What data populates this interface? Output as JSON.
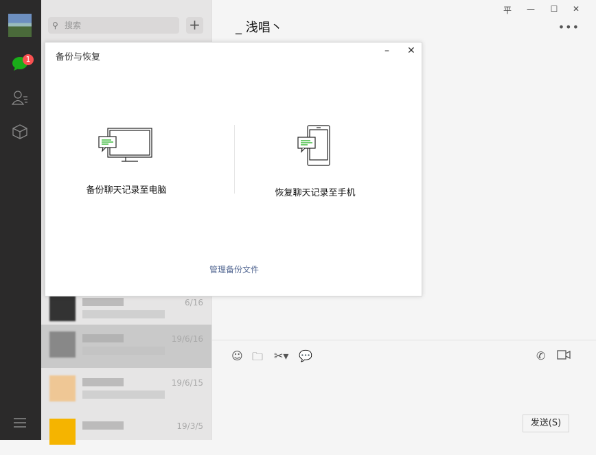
{
  "sidebar": {
    "unread_badge": "1",
    "items": [
      "chat-icon",
      "contacts-icon",
      "favorites-icon",
      "menu-icon"
    ]
  },
  "chat_list": {
    "search_placeholder": "搜索",
    "items": [
      {
        "time": "6/16"
      },
      {
        "time": "19/6/16"
      },
      {
        "time": "19/6/15"
      },
      {
        "time": "19/3/5"
      }
    ]
  },
  "main": {
    "title": "_ 浅唱丶",
    "send_label": "发送(S)",
    "window_controls": [
      "平",
      "—",
      "☐",
      "✕"
    ]
  },
  "dialog": {
    "title": "备份与恢复",
    "backup_label": "备份聊天记录至电脑",
    "restore_label": "恢复聊天记录至手机",
    "manage_label": "管理备份文件"
  },
  "colors": {
    "accent_green": "#1aad19",
    "link": "#576b95",
    "badge": "#fa5151"
  }
}
